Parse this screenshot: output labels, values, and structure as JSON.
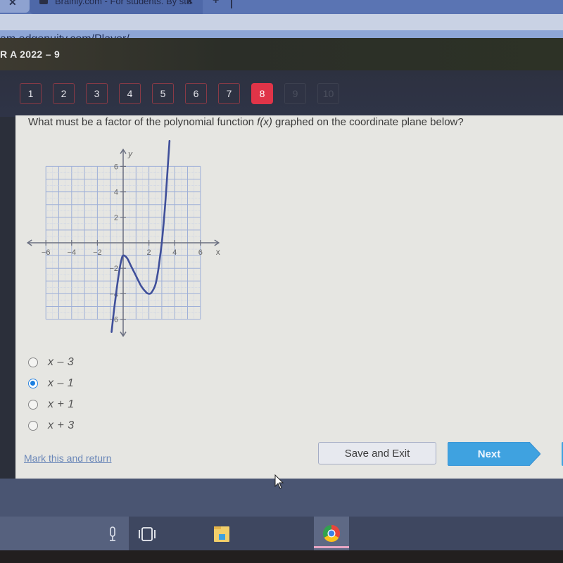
{
  "browser": {
    "tabs": [
      {
        "label": "",
        "close_icon": "✕"
      },
      {
        "label": "Brainly.com - For students. By stu",
        "close_icon": "✕",
        "active": true
      }
    ],
    "new_tab_icon": "+",
    "address": "am.edgenuity.com/Player/"
  },
  "course": {
    "title": "R A 2022 – 9"
  },
  "question_nav": {
    "items": [
      {
        "label": "1",
        "state": "answered"
      },
      {
        "label": "2",
        "state": "answered"
      },
      {
        "label": "3",
        "state": "answered"
      },
      {
        "label": "4",
        "state": "answered"
      },
      {
        "label": "5",
        "state": "answered"
      },
      {
        "label": "6",
        "state": "answered"
      },
      {
        "label": "7",
        "state": "answered"
      },
      {
        "label": "8",
        "state": "current"
      },
      {
        "label": "9",
        "state": "locked"
      },
      {
        "label": "10",
        "state": "locked"
      }
    ]
  },
  "question": {
    "prefix": "What must be a factor of the polynomial function ",
    "func": "f(x)",
    "suffix": " graphed on the coordinate plane below?"
  },
  "graph": {
    "x_label": "x",
    "y_label": "y",
    "x_range": [
      -6,
      6
    ],
    "y_range": [
      -6,
      6
    ],
    "x_ticks": [
      "−6",
      "−4",
      "−2",
      "2",
      "4",
      "6"
    ],
    "x_tick_values": [
      -6,
      -4,
      -2,
      2,
      4,
      6
    ],
    "y_ticks": [
      "6",
      "4",
      "2",
      "−2",
      "−4",
      "−6"
    ],
    "y_tick_values": [
      6,
      4,
      2,
      -2,
      -4,
      -6
    ],
    "curve_color": "#3f4f9a",
    "curve_points": [
      [
        -0.9,
        -7.0
      ],
      [
        -0.7,
        -5.2
      ],
      [
        -0.5,
        -3.6
      ],
      [
        -0.3,
        -2.2
      ],
      [
        -0.15,
        -1.4
      ],
      [
        0,
        -1.0
      ],
      [
        0.3,
        -1.2
      ],
      [
        0.6,
        -1.8
      ],
      [
        1.0,
        -2.6
      ],
      [
        1.4,
        -3.4
      ],
      [
        1.8,
        -3.9
      ],
      [
        2.0,
        -4.0
      ],
      [
        2.2,
        -3.9
      ],
      [
        2.5,
        -3.3
      ],
      [
        2.7,
        -2.3
      ],
      [
        2.85,
        -1.2
      ],
      [
        3.0,
        0.0
      ],
      [
        3.15,
        1.6
      ],
      [
        3.3,
        3.5
      ],
      [
        3.5,
        6.5
      ],
      [
        3.6,
        8.0
      ]
    ]
  },
  "choices": [
    {
      "label": "x – 3",
      "selected": false
    },
    {
      "label": "x – 1",
      "selected": true
    },
    {
      "label": "x + 1",
      "selected": false
    },
    {
      "label": "x + 3",
      "selected": false
    }
  ],
  "footer": {
    "mark_link": "Mark this and return",
    "save_button": "Save and Exit",
    "next_button": "Next"
  },
  "colors": {
    "current_question": "#e03448",
    "next_button": "#3fa2e0",
    "radio_selected": "#1c7fe0"
  },
  "taskbar": {
    "icons": [
      "microphone-icon",
      "task-view-icon",
      "file-explorer-icon",
      "chrome-icon"
    ]
  }
}
